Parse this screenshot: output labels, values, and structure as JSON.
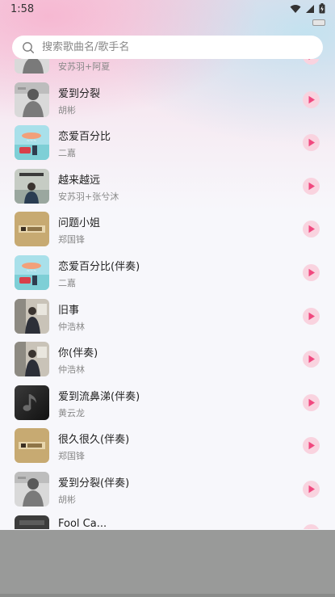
{
  "status_bar": {
    "time": "1:58",
    "icons": [
      "wifi-icon",
      "signal-icon",
      "battery-icon"
    ]
  },
  "search": {
    "placeholder": "搜索歌曲名/歌手名",
    "value": ""
  },
  "colors": {
    "play_bg": "#f9d3df",
    "play_fg": "#f0497f",
    "bottom_overlay": "#999a99"
  },
  "songs": [
    {
      "title": "",
      "artist": "安苏羽+阿夏",
      "cover": "photo-gray"
    },
    {
      "title": "爱到分裂",
      "artist": "胡彬",
      "cover": "photo-gray"
    },
    {
      "title": "恋爱百分比",
      "artist": "二嘉",
      "cover": "beach"
    },
    {
      "title": "越来越远",
      "artist": "安苏羽+张兮沐",
      "cover": "sky-person"
    },
    {
      "title": "问题小姐",
      "artist": "郑国锋",
      "cover": "gold-logo"
    },
    {
      "title": "恋爱百分比(伴奏)",
      "artist": "二嘉",
      "cover": "beach"
    },
    {
      "title": "旧事",
      "artist": "仲浩林",
      "cover": "room-person"
    },
    {
      "title": "你(伴奏)",
      "artist": "仲浩林",
      "cover": "room-person"
    },
    {
      "title": "爱到流鼻涕(伴奏)",
      "artist": "黄云龙",
      "cover": "music-note"
    },
    {
      "title": "很久很久(伴奏)",
      "artist": "郑国锋",
      "cover": "gold-logo"
    },
    {
      "title": "爱到分裂(伴奏)",
      "artist": "胡彬",
      "cover": "photo-gray"
    },
    {
      "title": "Fool Ca...",
      "artist": "",
      "cover": "dark"
    }
  ]
}
